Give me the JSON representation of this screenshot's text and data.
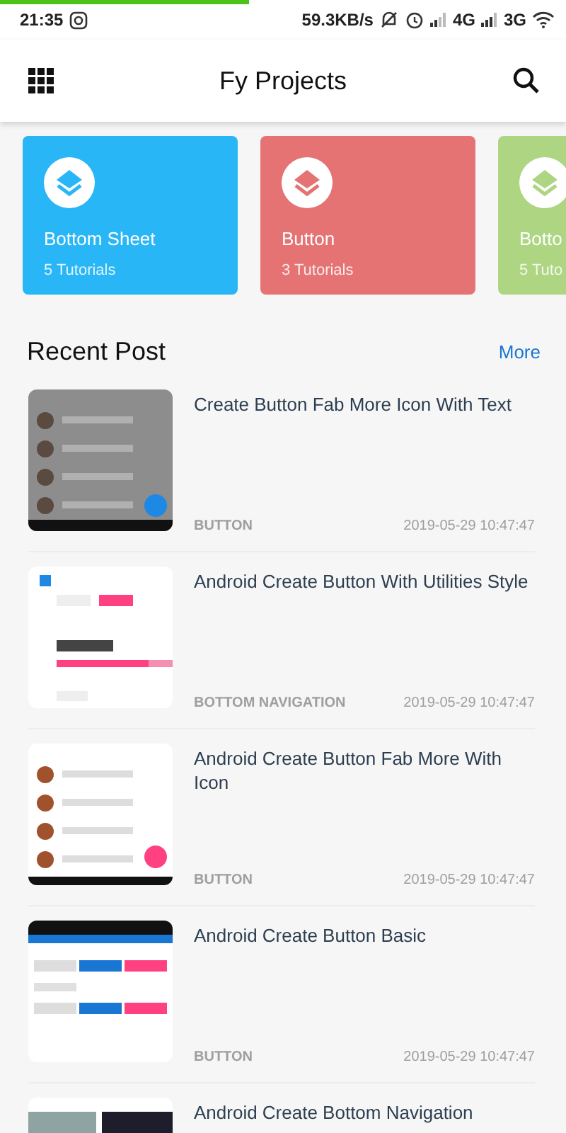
{
  "status_bar": {
    "loading": {
      "level": 0.44
    },
    "time": "21:35",
    "speed": "59.3KB/s",
    "network_1": "4G",
    "network_2": "3G"
  },
  "app_bar": {
    "title": "Fy Projects"
  },
  "categories": [
    {
      "title": "Bottom Sheet",
      "count": "5 Tutorials",
      "color": "#29b6f6"
    },
    {
      "title": "Button",
      "count": "3 Tutorials",
      "color": "#e57373"
    },
    {
      "title": "Botto",
      "count": "5 Tuto",
      "color": "#aed581"
    }
  ],
  "recent": {
    "heading": "Recent Post",
    "more": "More"
  },
  "posts": [
    {
      "title": "Create Button Fab More Icon With Text",
      "category": "BUTTON",
      "date": "2019-05-29 10:47:47"
    },
    {
      "title": "Android Create Button With Utilities Style",
      "category": "BOTTOM NAVIGATION",
      "date": "2019-05-29 10:47:47"
    },
    {
      "title": "Android Create Button Fab More With Icon",
      "category": "BUTTON",
      "date": "2019-05-29 10:47:47"
    },
    {
      "title": "Android Create Button Basic",
      "category": "BUTTON",
      "date": "2019-05-29 10:47:47"
    },
    {
      "title": "Android Create Bottom Navigation"
    }
  ]
}
